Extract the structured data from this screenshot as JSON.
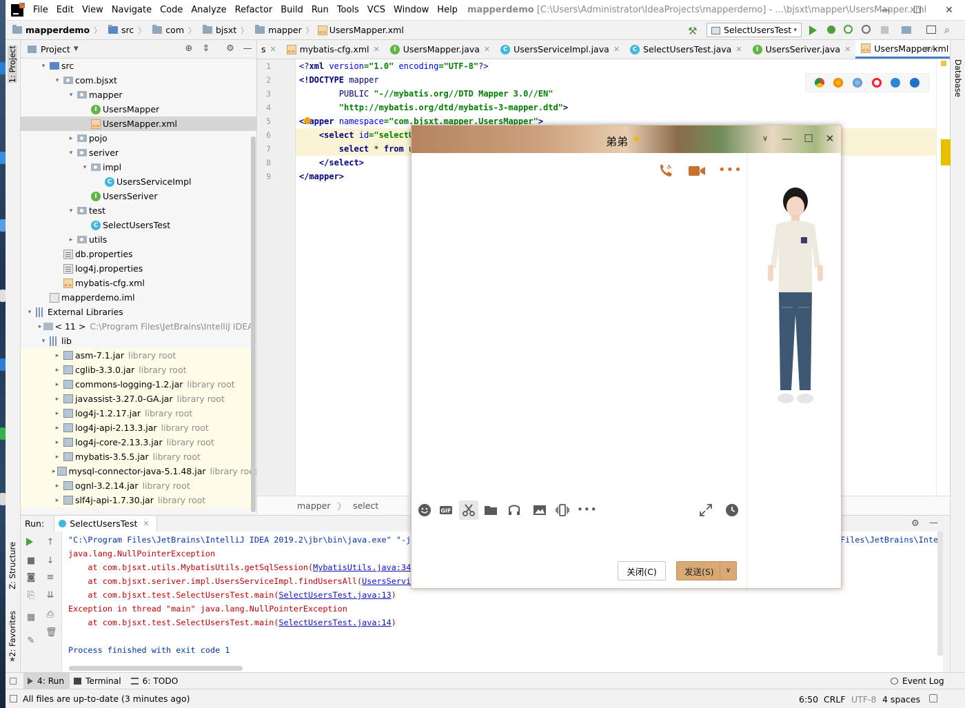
{
  "menubar": {
    "items": [
      "File",
      "Edit",
      "View",
      "Navigate",
      "Code",
      "Analyze",
      "Refactor",
      "Build",
      "Run",
      "Tools",
      "VCS",
      "Window",
      "Help"
    ],
    "project_name": "mapperdemo",
    "path": "[C:\\Users\\Administrator\\IdeaProjects\\mapperdemo] - ...\\bjsxt\\mapper\\UsersMapper.xml"
  },
  "navbar": {
    "crumbs": [
      "mapperdemo",
      "src",
      "com",
      "bjsxt",
      "mapper",
      "UsersMapper.xml"
    ],
    "run_config": "SelectUsersTest"
  },
  "project_panel": {
    "title": "Project",
    "tree": [
      {
        "label": "src",
        "icon": "folder-src-icon",
        "arrow": "▾",
        "indent": 1
      },
      {
        "label": "com.bjsxt",
        "icon": "package-icon",
        "arrow": "▾",
        "indent": 2
      },
      {
        "label": "mapper",
        "icon": "package-icon",
        "arrow": "▾",
        "indent": 3
      },
      {
        "label": "UsersMapper",
        "icon": "interface-icon",
        "arrow": "",
        "indent": 4
      },
      {
        "label": "UsersMapper.xml",
        "icon": "xml-file-icon",
        "arrow": "",
        "indent": 4,
        "selected": true
      },
      {
        "label": "pojo",
        "icon": "package-icon",
        "arrow": "▸",
        "indent": 3
      },
      {
        "label": "seriver",
        "icon": "package-icon",
        "arrow": "▾",
        "indent": 3
      },
      {
        "label": "impl",
        "icon": "package-icon",
        "arrow": "▾",
        "indent": 4
      },
      {
        "label": "UsersServiceImpl",
        "icon": "class-icon",
        "arrow": "",
        "indent": 5
      },
      {
        "label": "UsersSeriver",
        "icon": "interface-icon",
        "arrow": "",
        "indent": 4
      },
      {
        "label": "test",
        "icon": "package-icon",
        "arrow": "▾",
        "indent": 3
      },
      {
        "label": "SelectUsersTest",
        "icon": "class-icon",
        "arrow": "",
        "indent": 4
      },
      {
        "label": "utils",
        "icon": "package-icon",
        "arrow": "▸",
        "indent": 3
      },
      {
        "label": "db.properties",
        "icon": "properties-file-icon",
        "arrow": "",
        "indent": 2
      },
      {
        "label": "log4j.properties",
        "icon": "properties-file-icon",
        "arrow": "",
        "indent": 2
      },
      {
        "label": "mybatis-cfg.xml",
        "icon": "xml-file-icon",
        "arrow": "",
        "indent": 2
      },
      {
        "label": "mapperdemo.iml",
        "icon": "iml-file-icon",
        "arrow": "",
        "indent": 1
      },
      {
        "label": "External Libraries",
        "icon": "libraries-icon",
        "arrow": "▾",
        "indent": 0
      },
      {
        "label": "< 11 >",
        "muted": "C:\\Program Files\\JetBrains\\IntelliJ IDEA 2",
        "icon": "jdk-icon",
        "arrow": "▸",
        "indent": 1
      },
      {
        "label": "lib",
        "icon": "libraries-icon",
        "arrow": "▾",
        "indent": 1
      },
      {
        "label": "asm-7.1.jar",
        "muted": "library root",
        "icon": "jar-icon",
        "arrow": "▸",
        "indent": 2,
        "lib": true
      },
      {
        "label": "cglib-3.3.0.jar",
        "muted": "library root",
        "icon": "jar-icon",
        "arrow": "▸",
        "indent": 2,
        "lib": true
      },
      {
        "label": "commons-logging-1.2.jar",
        "muted": "library root",
        "icon": "jar-icon",
        "arrow": "▸",
        "indent": 2,
        "lib": true
      },
      {
        "label": "javassist-3.27.0-GA.jar",
        "muted": "library root",
        "icon": "jar-icon",
        "arrow": "▸",
        "indent": 2,
        "lib": true
      },
      {
        "label": "log4j-1.2.17.jar",
        "muted": "library root",
        "icon": "jar-icon",
        "arrow": "▸",
        "indent": 2,
        "lib": true
      },
      {
        "label": "log4j-api-2.13.3.jar",
        "muted": "library root",
        "icon": "jar-icon",
        "arrow": "▸",
        "indent": 2,
        "lib": true
      },
      {
        "label": "log4j-core-2.13.3.jar",
        "muted": "library root",
        "icon": "jar-icon",
        "arrow": "▸",
        "indent": 2,
        "lib": true
      },
      {
        "label": "mybatis-3.5.5.jar",
        "muted": "library root",
        "icon": "jar-icon",
        "arrow": "▸",
        "indent": 2,
        "lib": true
      },
      {
        "label": "mysql-connector-java-5.1.48.jar",
        "muted": "library root",
        "icon": "jar-icon",
        "arrow": "▸",
        "indent": 2,
        "lib": true
      },
      {
        "label": "ognl-3.2.14.jar",
        "muted": "library root",
        "icon": "jar-icon",
        "arrow": "▸",
        "indent": 2,
        "lib": true
      },
      {
        "label": "slf4j-api-1.7.30.jar",
        "muted": "library root",
        "icon": "jar-icon",
        "arrow": "▸",
        "indent": 2,
        "lib": true
      }
    ]
  },
  "tabs": [
    {
      "label": "s",
      "icon": "",
      "active": false
    },
    {
      "label": "mybatis-cfg.xml",
      "icon": "xml-file-icon",
      "active": false
    },
    {
      "label": "UsersMapper.java",
      "icon": "interface-icon",
      "active": false
    },
    {
      "label": "UsersServiceImpl.java",
      "icon": "class-icon",
      "active": false
    },
    {
      "label": "SelectUsersTest.java",
      "icon": "class-icon",
      "active": false
    },
    {
      "label": "UsersSeriver.java",
      "icon": "interface-icon",
      "active": false
    },
    {
      "label": "UsersMapper.xml",
      "icon": "xml-file-icon",
      "active": true
    }
  ],
  "tab_overflow": "≡4",
  "editor": {
    "line_numbers": [
      "1",
      "2",
      "3",
      "4",
      "5",
      "6",
      "7",
      "8",
      "9"
    ],
    "breadcrumbs": [
      "mapper",
      "select"
    ]
  },
  "side_labels": {
    "project": "1: Project",
    "structure": "Z: Structure",
    "favorites": "2: Favorites",
    "database": "Database"
  },
  "run_panel": {
    "label": "Run:",
    "tab": "SelectUsersTest",
    "lines": [
      {
        "text": "\"C:\\Program Files\\JetBrains\\IntelliJ IDEA 2019.2\\jbr\\bin\\java.exe\" \"-ja",
        "cls": "norm"
      },
      {
        "text": "java.lang.NullPointerException",
        "cls": "err"
      },
      {
        "pre": "    at com.bjsxt.utils.MybatisUtils.getSqlSession(",
        "link": "MybatisUtils.java:34",
        "post": ")",
        "cls": "err"
      },
      {
        "pre": "    at com.bjsxt.seriver.impl.UsersServiceImpl.findUsersAll(",
        "link": "UsersServic",
        "post": "",
        "cls": "err"
      },
      {
        "pre": "    at com.bjsxt.test.SelectUsersTest.main(",
        "link": "SelectUsersTest.java:13",
        "post": ")",
        "cls": "err"
      },
      {
        "text": "Exception in thread \"main\" java.lang.NullPointerException",
        "cls": "err"
      },
      {
        "pre": "    at com.bjsxt.test.SelectUsersTest.main(",
        "link": "SelectUsersTest.java:14",
        "post": ")",
        "cls": "err"
      },
      {
        "text": "",
        "cls": "norm"
      },
      {
        "text": "Process finished with exit code 1",
        "cls": "norm"
      }
    ],
    "right_fragment": "Files\\JetBrains\\Intell"
  },
  "bottom_tools": {
    "run": "4: Run",
    "terminal": "Terminal",
    "todo": "6: TODO",
    "event_log": "Event Log"
  },
  "status": {
    "message": "All files are up-to-date (3 minutes ago)",
    "position": "6:50",
    "line_sep": "CRLF",
    "encoding": "UTF-8",
    "indent": "4 spaces"
  },
  "chat": {
    "title": "弟弟",
    "close_button": "关闭(C)",
    "send_button": "发送(S)"
  },
  "colors": {
    "accent": "#4083c9",
    "chat_send": "#d9a975",
    "error_text": "#c60000"
  }
}
